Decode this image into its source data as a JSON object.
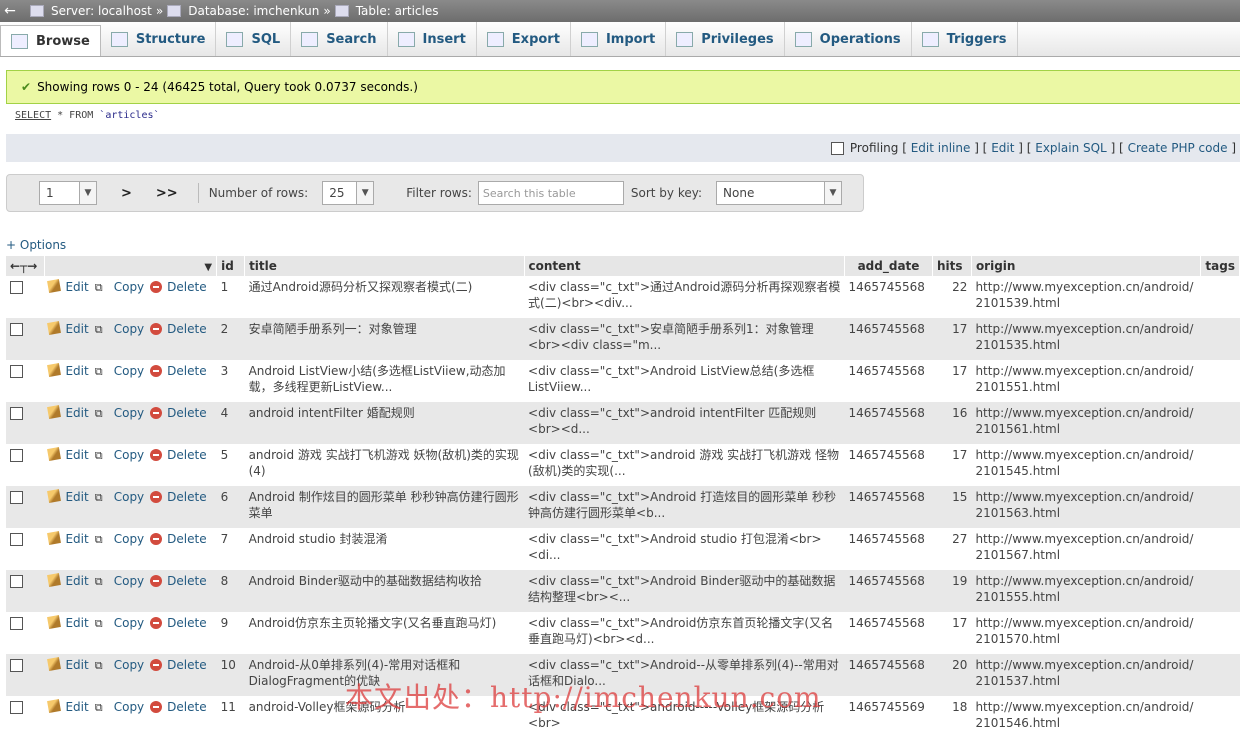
{
  "breadcrumb": {
    "server": "Server: localhost",
    "database": "Database: imchenkun",
    "table": "Table: articles",
    "sep": "»"
  },
  "tabs": [
    {
      "label": "Browse",
      "icon": "browse-icon"
    },
    {
      "label": "Structure",
      "icon": "structure-icon"
    },
    {
      "label": "SQL",
      "icon": "sql-icon"
    },
    {
      "label": "Search",
      "icon": "search-icon"
    },
    {
      "label": "Insert",
      "icon": "insert-icon"
    },
    {
      "label": "Export",
      "icon": "export-icon"
    },
    {
      "label": "Import",
      "icon": "import-icon"
    },
    {
      "label": "Privileges",
      "icon": "privileges-icon"
    },
    {
      "label": "Operations",
      "icon": "operations-icon"
    },
    {
      "label": "Triggers",
      "icon": "triggers-icon"
    }
  ],
  "notice": "Showing rows 0 - 24 (46425 total, Query took 0.0737 seconds.)",
  "query": {
    "select": "SELECT",
    "rest": " * FROM ",
    "table": "`articles`"
  },
  "profiling": {
    "label": "Profiling",
    "links": [
      "Edit inline",
      "Edit",
      "Explain SQL",
      "Create PHP code"
    ]
  },
  "nav": {
    "page": "1",
    "next": ">",
    "last": ">>",
    "rows_label": "Number of rows:",
    "rows_value": "25",
    "filter_label": "Filter rows:",
    "filter_placeholder": "Search this table",
    "sort_label": "Sort by key:",
    "sort_value": "None"
  },
  "options_label": "+ Options",
  "columns": [
    "id",
    "title",
    "content",
    "add_date",
    "hits",
    "origin",
    "tags"
  ],
  "actions": {
    "edit": "Edit",
    "copy": "Copy",
    "delete": "Delete"
  },
  "rows": [
    {
      "id": "1",
      "title": "通过Android源码分析又探观察者模式(二)",
      "content": "<div class=\"c_txt\">通过Android源码分析再探观察者模式(二)<br><div...",
      "add_date": "1465745568",
      "hits": "22",
      "origin": "http://www.myexception.cn/android/2101539.html",
      "tags": ""
    },
    {
      "id": "2",
      "title": "安卓简陋手册系列一：对象管理",
      "content": "<div class=\"c_txt\">安卓简陋手册系列1：对象管理<br><div class=\"m...",
      "add_date": "1465745568",
      "hits": "17",
      "origin": "http://www.myexception.cn/android/2101535.html",
      "tags": ""
    },
    {
      "id": "3",
      "title": "Android ListView小结(多选框ListViiew,动态加载，多线程更新ListView...",
      "content": "<div class=\"c_txt\">Android ListView总结(多选框ListViiew...",
      "add_date": "1465745568",
      "hits": "17",
      "origin": "http://www.myexception.cn/android/2101551.html",
      "tags": ""
    },
    {
      "id": "4",
      "title": "android intentFilter 婚配规则",
      "content": "<div class=\"c_txt\">android intentFilter 匹配规则<br><d...",
      "add_date": "1465745568",
      "hits": "16",
      "origin": "http://www.myexception.cn/android/2101561.html",
      "tags": ""
    },
    {
      "id": "5",
      "title": "android 游戏 实战打飞机游戏 妖物(敌机)类的实现(4)",
      "content": "<div class=\"c_txt\">android 游戏 实战打飞机游戏 怪物(敌机)类的实现(...",
      "add_date": "1465745568",
      "hits": "17",
      "origin": "http://www.myexception.cn/android/2101545.html",
      "tags": ""
    },
    {
      "id": "6",
      "title": "Android 制作炫目的圆形菜单 秒秒钟高仿建行圆形菜单",
      "content": "<div class=\"c_txt\">Android 打造炫目的圆形菜单 秒秒钟高仿建行圆形菜单<b...",
      "add_date": "1465745568",
      "hits": "15",
      "origin": "http://www.myexception.cn/android/2101563.html",
      "tags": ""
    },
    {
      "id": "7",
      "title": "Android studio 封装混淆",
      "content": "<div class=\"c_txt\">Android studio 打包混淆<br>    <di...",
      "add_date": "1465745568",
      "hits": "27",
      "origin": "http://www.myexception.cn/android/2101567.html",
      "tags": ""
    },
    {
      "id": "8",
      "title": "Android Binder驱动中的基础数据结构收拾",
      "content": "<div class=\"c_txt\">Android Binder驱动中的基础数据结构整理<br><...",
      "add_date": "1465745568",
      "hits": "19",
      "origin": "http://www.myexception.cn/android/2101555.html",
      "tags": ""
    },
    {
      "id": "9",
      "title": "Android仿京东主页轮播文字(又名垂直跑马灯)",
      "content": "<div class=\"c_txt\">Android仿京东首页轮播文字(又名垂直跑马灯)<br><d...",
      "add_date": "1465745568",
      "hits": "17",
      "origin": "http://www.myexception.cn/android/2101570.html",
      "tags": ""
    },
    {
      "id": "10",
      "title": "Android-从0单排系列(4)-常用对话框和DialogFragment的优缺",
      "content": "<div class=\"c_txt\">Android--从零单排系列(4)--常用对话框和Dialo...",
      "add_date": "1465745568",
      "hits": "20",
      "origin": "http://www.myexception.cn/android/2101537.html",
      "tags": ""
    },
    {
      "id": "11",
      "title": "android-Volley框架源码分析",
      "content": "<div class=\"c_txt\">android-----Volley框架源码分析<br>",
      "add_date": "1465745569",
      "hits": "18",
      "origin": "http://www.myexception.cn/android/2101546.html",
      "tags": ""
    }
  ],
  "watermark": "本文出处：http://imchenkun.com"
}
